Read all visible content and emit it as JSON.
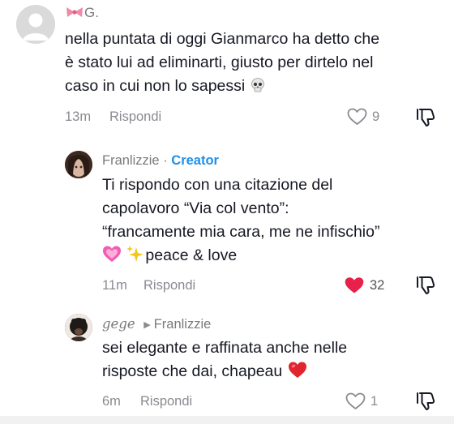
{
  "comments": [
    {
      "username": "G.",
      "text_lines": [
        "nella puntata di oggi Gianmarco ha detto che",
        "è stato lui ad eliminarti, giusto per dirtelo nel",
        "caso in cui non lo sapessi"
      ],
      "time": "13m",
      "reply_label": "Rispondi",
      "likes": "9",
      "liked": false
    },
    {
      "username": "Franlizzie",
      "separator": " · ",
      "creator_label": "Creator",
      "text_lines": [
        "Ti rispondo con una citazione del",
        "capolavoro “Via col vento”:",
        "“francamente mia cara, me ne infischio”",
        "peace & love"
      ],
      "time": "11m",
      "reply_label": "Rispondi",
      "likes": "32",
      "liked": true
    },
    {
      "username": "gege",
      "reply_to": "Franlizzie",
      "text_lines": [
        "sei elegante e raffinata anche nelle",
        "risposte che dai, chapeau"
      ],
      "time": "6m",
      "reply_label": "Rispondi",
      "likes": "1",
      "liked": false
    }
  ],
  "colors": {
    "creator": "#1e8fe8",
    "liked_heart": "#e8204a",
    "muted": "#8a8b91"
  },
  "icons": [
    "default-avatar-icon",
    "bow-emoji-icon",
    "skull-emoji-icon",
    "heart-outline-icon",
    "heart-filled-icon",
    "dislike-icon",
    "pink-heart-emoji-icon",
    "sparkles-emoji-icon",
    "red-heart-emoji-icon",
    "reply-arrow-icon"
  ]
}
